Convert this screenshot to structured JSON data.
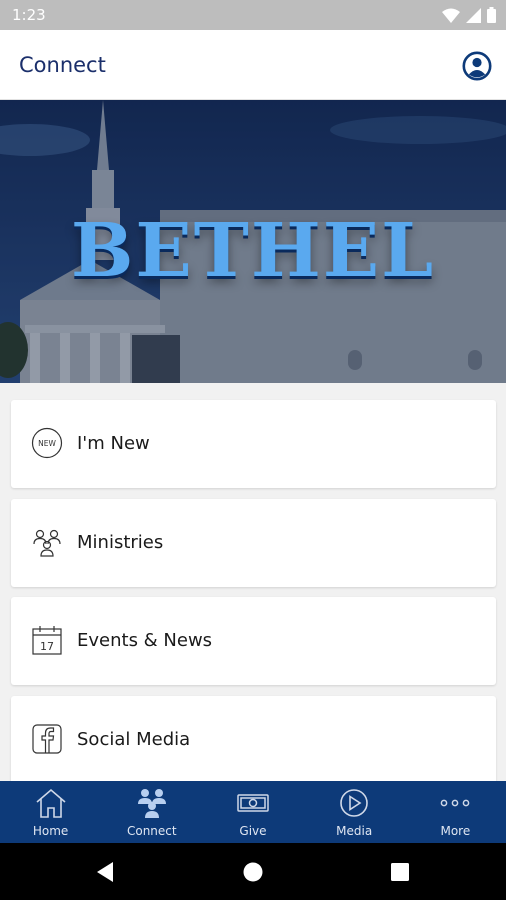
{
  "status_bar": {
    "time": "1:23"
  },
  "app_bar": {
    "title": "Connect",
    "profile_icon": "person-circle-icon"
  },
  "hero": {
    "text": "BETHEL"
  },
  "menu": [
    {
      "label": "I'm New",
      "icon": "new-badge-icon",
      "badge_text": "NEW"
    },
    {
      "label": "Ministries",
      "icon": "group-icon"
    },
    {
      "label": "Events & News",
      "icon": "calendar-icon",
      "date_number": "17"
    },
    {
      "label": "Social Media",
      "icon": "facebook-icon"
    }
  ],
  "tab_bar": {
    "tabs": [
      {
        "label": "Home",
        "icon": "home-icon"
      },
      {
        "label": "Connect",
        "icon": "connect-icon"
      },
      {
        "label": "Give",
        "icon": "money-icon"
      },
      {
        "label": "Media",
        "icon": "play-icon"
      },
      {
        "label": "More",
        "icon": "more-dots-icon"
      }
    ]
  },
  "colors": {
    "brand_navy": "#0d3a79",
    "title": "#1b2f6b",
    "hero_text": "#5aa9ef"
  }
}
